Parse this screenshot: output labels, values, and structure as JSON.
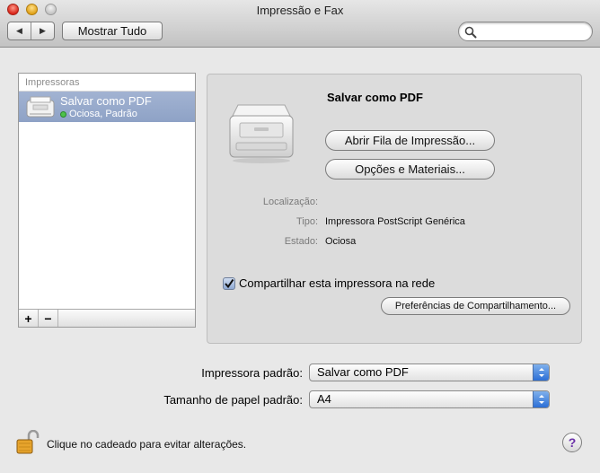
{
  "window": {
    "title": "Impressão e Fax"
  },
  "toolbar": {
    "back_glyph": "◀",
    "forward_glyph": "▶",
    "show_all_label": "Mostrar Tudo",
    "search_value": "",
    "search_icon": "magnifier-icon"
  },
  "printers": {
    "header": "Impressoras",
    "items": [
      {
        "name": "Salvar como PDF",
        "status": "Ociosa, Padrão",
        "selected": true
      }
    ],
    "add_label": "+",
    "remove_label": "−"
  },
  "detail": {
    "name": "Salvar como PDF",
    "open_queue_label": "Abrir Fila de Impressão...",
    "options_label": "Opções e Materiais...",
    "location_label": "Localização:",
    "location_value": "",
    "type_label": "Tipo:",
    "type_value": "Impressora PostScript Genérica",
    "state_label": "Estado:",
    "state_value": "Ociosa",
    "share_label": "Compartilhar esta impressora na rede",
    "share_checked": true,
    "sharing_prefs_label": "Preferências de Compartilhamento..."
  },
  "defaults": {
    "printer_label": "Impressora padrão:",
    "printer_value": "Salvar como PDF",
    "paper_label": "Tamanho de papel padrão:",
    "paper_value": "A4"
  },
  "footer": {
    "lock_text": "Clique no cadeado para evitar alterações.",
    "help_label": "?"
  },
  "colors": {
    "selection": "#98aace",
    "accent_blue": "#3a7bd5",
    "status_green": "#4ec24a"
  }
}
